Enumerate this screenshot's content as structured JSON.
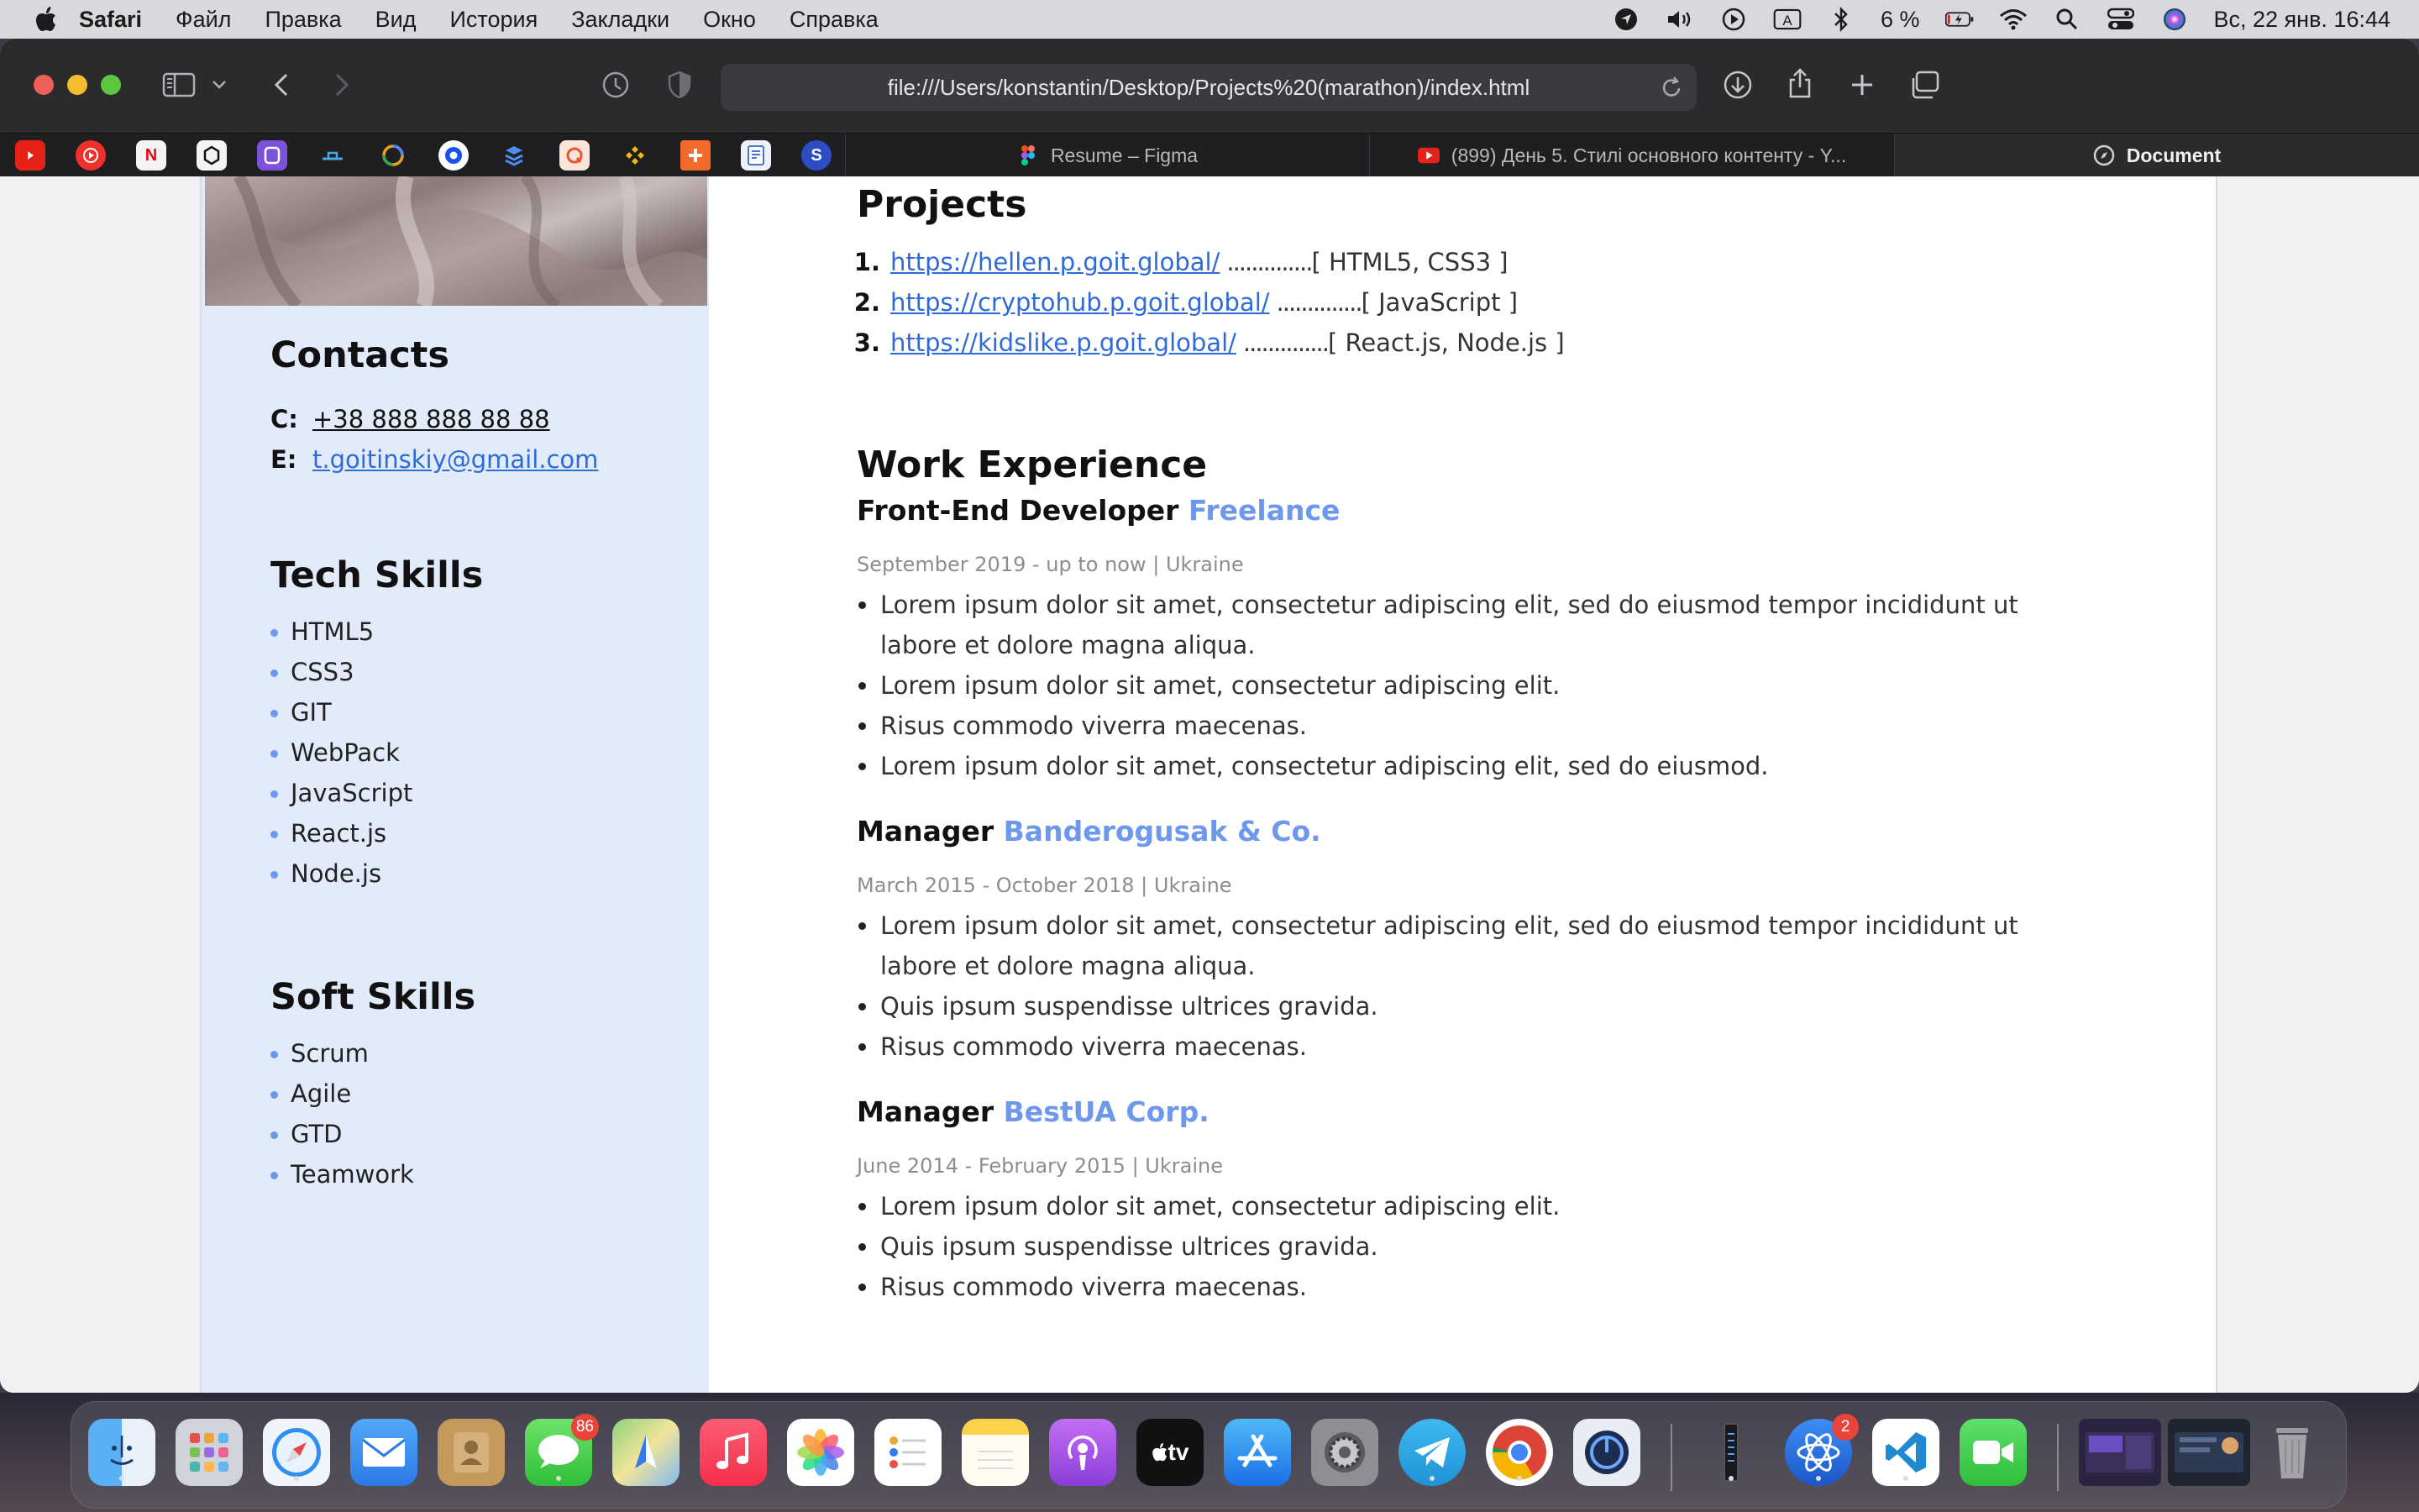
{
  "menubar": {
    "app_name": "Safari",
    "items": [
      "Файл",
      "Правка",
      "Вид",
      "История",
      "Закладки",
      "Окно",
      "Справка"
    ],
    "battery_percent": "6 %",
    "datetime": "Вс, 22 янв.  16:44",
    "input_badge": "A"
  },
  "browser": {
    "address": "file:///Users/konstantin/Desktop/Projects%20(marathon)/index.html",
    "tabs": [
      {
        "label": "Resume – Figma",
        "icon": "figma-icon"
      },
      {
        "label": "(899) День 5. Стилі основного контенту - Y...",
        "icon": "youtube-icon"
      },
      {
        "label": "Document",
        "icon": "compass-icon"
      }
    ],
    "pinned_favicons": [
      "youtube",
      "youtube-music",
      "netflix",
      "chatgpt",
      "proton",
      "bitwarden",
      "chrome-circle",
      "coinbase",
      "fork",
      "quora",
      "binance",
      "plus",
      "docs",
      "stripe"
    ]
  },
  "sidebar": {
    "contacts_title": "Contacts",
    "phone_label": "C:",
    "phone": "+38 888 888 88 88",
    "email_label": "E:",
    "email": "t.goitinskiy@gmail.com",
    "tech_title": "Tech Skills",
    "tech_skills": [
      "HTML5",
      "CSS3",
      "GIT",
      "WebPack",
      "JavaScript",
      "React.js",
      "Node.js"
    ],
    "soft_title": "Soft Skills",
    "soft_skills": [
      "Scrum",
      "Agile",
      "GTD",
      "Teamwork"
    ]
  },
  "main": {
    "projects_title": "Projects",
    "projects": [
      {
        "num": "1.",
        "url": "https://hellen.p.goit.global/",
        "dots": "..............",
        "stack": "[ HTML5, CSS3 ]"
      },
      {
        "num": "2.",
        "url": "https://cryptohub.p.goit.global/",
        "dots": "..............",
        "stack": "[ JavaScript ]"
      },
      {
        "num": "3.",
        "url": "https://kidslike.p.goit.global/",
        "dots": "..............",
        "stack": "[ React.js, Node.js ]"
      }
    ],
    "experience_title": "Work Experience",
    "jobs": [
      {
        "role": "Front-End Developer",
        "company": "Freelance",
        "meta": "September 2019 - up to now | Ukraine",
        "bullets": [
          "Lorem ipsum dolor sit amet, consectetur adipiscing elit, sed do eiusmod tempor incididunt ut labore et dolore magna aliqua.",
          "Lorem ipsum dolor sit amet, consectetur adipiscing elit.",
          "Risus commodo viverra maecenas.",
          "Lorem ipsum dolor sit amet, consectetur adipiscing elit, sed do eiusmod."
        ]
      },
      {
        "role": "Manager",
        "company": "Banderogusak & Co.",
        "meta": "March 2015 - October 2018 | Ukraine",
        "bullets": [
          "Lorem ipsum dolor sit amet, consectetur adipiscing elit, sed do eiusmod tempor incididunt ut labore et dolore magna aliqua.",
          "Quis ipsum suspendisse ultrices gravida.",
          "Risus commodo viverra maecenas."
        ]
      },
      {
        "role": "Manager",
        "company": "BestUA Corp.",
        "meta": "June 2014 - February 2015 | Ukraine",
        "bullets": [
          "Lorem ipsum dolor sit amet, consectetur adipiscing elit.",
          "Quis ipsum suspendisse ultrices gravida.",
          "Risus commodo viverra maecenas."
        ]
      }
    ]
  },
  "dock": {
    "apps": [
      "finder",
      "launchpad",
      "safari",
      "mail",
      "contacts",
      "messages",
      "maps",
      "music",
      "photos",
      "reminders",
      "notes",
      "podcasts",
      "tv",
      "app-store",
      "system-settings",
      "telegram",
      "chrome",
      "proxyman",
      "tower",
      "xcode-cloud",
      "vscode",
      "facetime"
    ],
    "messages_badge": "86",
    "xcode_badge": "2",
    "tv_label": "tv"
  },
  "colors": {
    "accent": "#6e97ee",
    "link": "#2f6bd8",
    "sidebar_bg": "#e2ebfa"
  }
}
